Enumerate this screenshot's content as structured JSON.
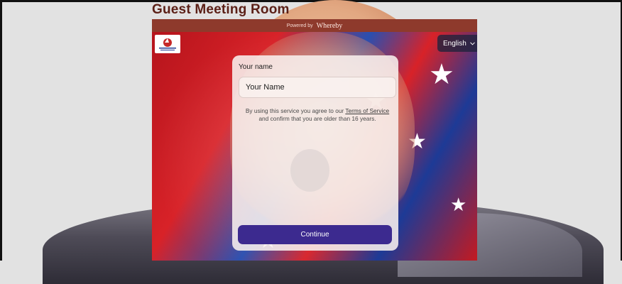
{
  "page": {
    "title": "Guest Meeting Room"
  },
  "embed": {
    "powered_by": "Powered by",
    "brand": "Whereby",
    "language": {
      "selected": "English"
    },
    "form": {
      "name_label": "Your name",
      "name_placeholder": "Your Name",
      "name_value": "",
      "terms_prefix": "By using this service you agree to our",
      "terms_link": "Terms of Service",
      "terms_suffix": "and confirm that you are older than 16 years.",
      "continue_label": "Continue"
    }
  },
  "colors": {
    "title": "#5b2017",
    "powered_bar": "#8e3a2c",
    "continue_button": "#3c2a8f",
    "language_button": "#1e233c"
  },
  "icons": {
    "logo": "ship-logo-icon",
    "language": "chevron-down-icon"
  }
}
